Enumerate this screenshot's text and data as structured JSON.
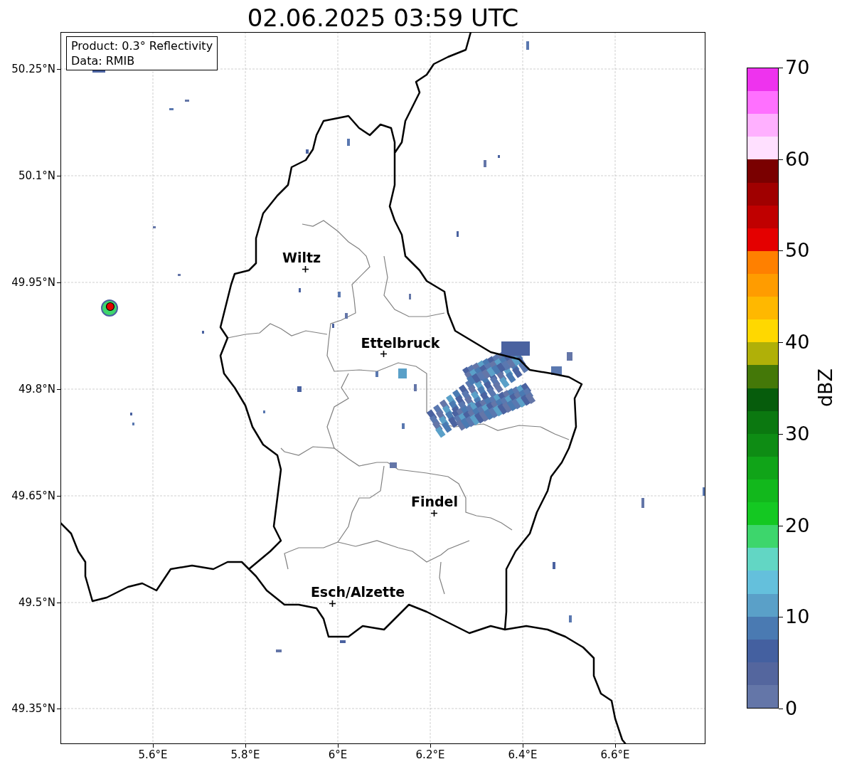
{
  "title": "02.06.2025 03:59 UTC",
  "legend": [
    "Product: 0.3° Reflectivity",
    "Data: RMIB"
  ],
  "map": {
    "yticks": [
      "50.25°N",
      "50.1°N",
      "49.95°N",
      "49.8°N",
      "49.65°N",
      "49.5°N",
      "49.35°N"
    ],
    "xticks": [
      "5.6°E",
      "5.8°E",
      "6°E",
      "6.2°E",
      "6.4°E",
      "6.6°E"
    ],
    "cities": [
      {
        "name": "Wiltz"
      },
      {
        "name": "Ettelbruck"
      },
      {
        "name": "Findel"
      },
      {
        "name": "Esch/Alzette"
      }
    ]
  },
  "colorbar": {
    "label": "dBZ",
    "ticks": [
      "70",
      "60",
      "50",
      "40",
      "30",
      "20",
      "10",
      "0"
    ],
    "segments": [
      {
        "color": "#ee33ee"
      },
      {
        "color": "#ff70ff"
      },
      {
        "color": "#ffb0ff"
      },
      {
        "color": "#ffe0ff"
      },
      {
        "color": "#7a0000"
      },
      {
        "color": "#a00000"
      },
      {
        "color": "#c00000"
      },
      {
        "color": "#e40000"
      },
      {
        "color": "#ff8000"
      },
      {
        "color": "#ff9c00"
      },
      {
        "color": "#ffb800"
      },
      {
        "color": "#ffd800"
      },
      {
        "color": "#b0b008"
      },
      {
        "color": "#447808"
      },
      {
        "color": "#065c0c"
      },
      {
        "color": "#0b7810"
      },
      {
        "color": "#0e8c14"
      },
      {
        "color": "#10a418"
      },
      {
        "color": "#12b81c"
      },
      {
        "color": "#14c822"
      },
      {
        "color": "#3dd66c"
      },
      {
        "color": "#62d6c4"
      },
      {
        "color": "#64c0dc"
      },
      {
        "color": "#5aa0c8"
      },
      {
        "color": "#4a7ab2"
      },
      {
        "color": "#4460a0"
      },
      {
        "color": "#54669e"
      },
      {
        "color": "#6476a8"
      }
    ]
  }
}
